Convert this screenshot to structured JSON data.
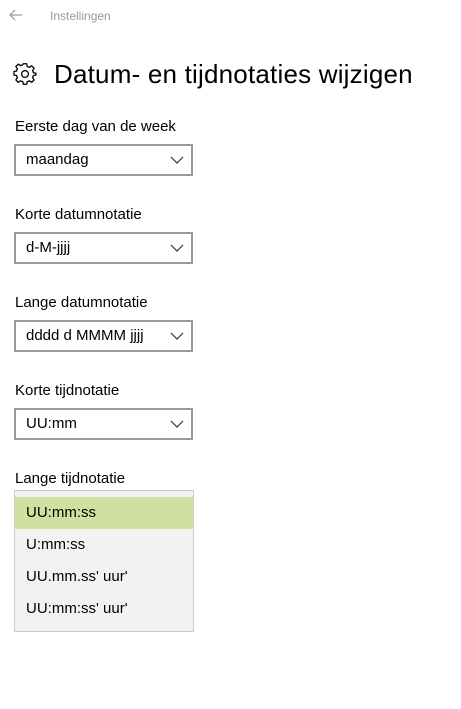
{
  "window": {
    "app_title": "Instellingen"
  },
  "header": {
    "title": "Datum- en tijdnotaties wijzigen",
    "icon": "gear-icon"
  },
  "fields": [
    {
      "label": "Eerste dag van de week",
      "value": "maandag"
    },
    {
      "label": "Korte datumnotatie",
      "value": "d-M-jjjj"
    },
    {
      "label": "Lange datumnotatie",
      "value": "dddd d MMMM jjjj"
    },
    {
      "label": "Korte tijdnotatie",
      "value": "UU:mm"
    }
  ],
  "long_time": {
    "label": "Lange tijdnotatie",
    "options": [
      "UU:mm:ss",
      "U:mm:ss",
      "UU.mm.ss' uur'",
      "UU:mm:ss' uur'"
    ],
    "selected": "UU:mm:ss"
  },
  "colors": {
    "selected_option": "#cfe0a1",
    "dropdown_background": "#f2f2f2",
    "combo_border": "#999999"
  }
}
